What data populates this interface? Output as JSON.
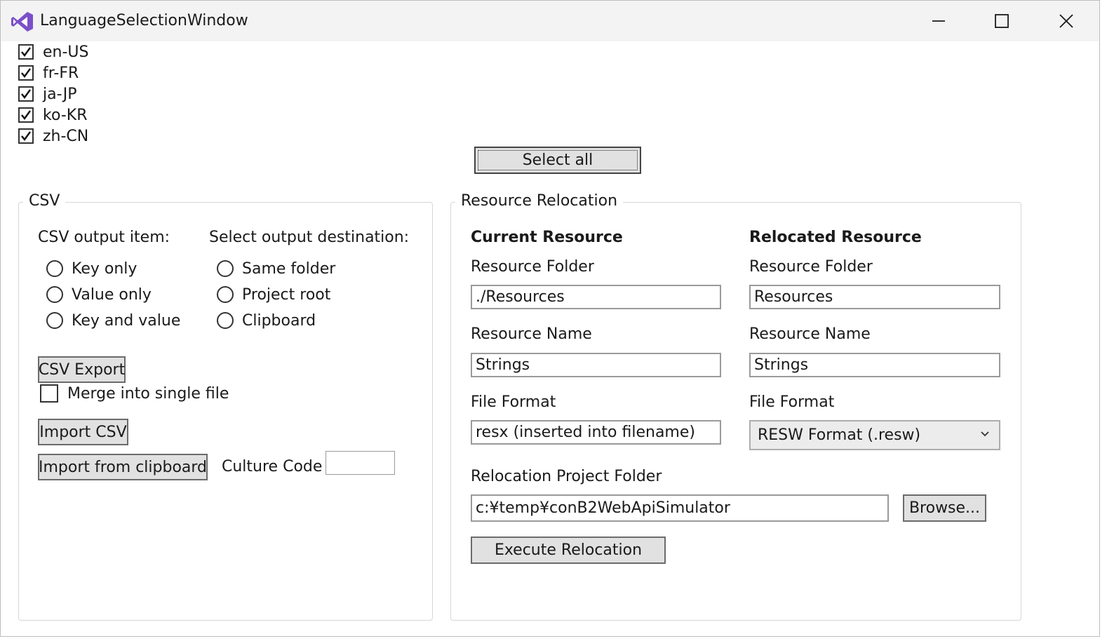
{
  "window": {
    "title": "LanguageSelectionWindow",
    "controls": {
      "minimize": "minimize-icon",
      "maximize": "maximize-icon",
      "close": "close-icon"
    }
  },
  "languages": [
    {
      "code": "en-US",
      "checked": true
    },
    {
      "code": "fr-FR",
      "checked": true
    },
    {
      "code": "ja-JP",
      "checked": true
    },
    {
      "code": "ko-KR",
      "checked": true
    },
    {
      "code": "zh-CN",
      "checked": true
    }
  ],
  "select_all_label": "Select all",
  "csv": {
    "group_title": "CSV",
    "output_item_label": "CSV output item:",
    "output_items": [
      "Key only",
      "Value only",
      "Key and value"
    ],
    "destination_label": "Select output destination:",
    "destinations": [
      "Same folder",
      "Project root",
      "Clipboard"
    ],
    "export_button": "CSV Export",
    "merge_label": "Merge into single file",
    "merge_checked": false,
    "import_button": "Import CSV",
    "import_clipboard_button": "Import from clipboard",
    "culture_code_label": "Culture Code",
    "culture_code_value": ""
  },
  "relocation": {
    "group_title": "Resource Relocation",
    "current": {
      "heading": "Current Resource",
      "folder_label": "Resource Folder",
      "folder_value": "./Resources",
      "name_label": "Resource Name",
      "name_value": "Strings",
      "format_label": "File Format",
      "format_value": "resx (inserted into filename)"
    },
    "relocated": {
      "heading": "Relocated Resource",
      "folder_label": "Resource Folder",
      "folder_value": "Resources",
      "name_label": "Resource Name",
      "name_value": "Strings",
      "format_label": "File Format",
      "format_selected": "RESW Format (.resw)"
    },
    "project_folder_label": "Relocation Project Folder",
    "project_folder_value": "c:¥temp¥conB2WebApiSimulator",
    "browse_button": "Browse...",
    "execute_button": "Execute Relocation"
  },
  "colors": {
    "accent_icon": "#7b4fc9",
    "button_face": "#e1e1e1",
    "titlebar": "#f3f3f3"
  }
}
